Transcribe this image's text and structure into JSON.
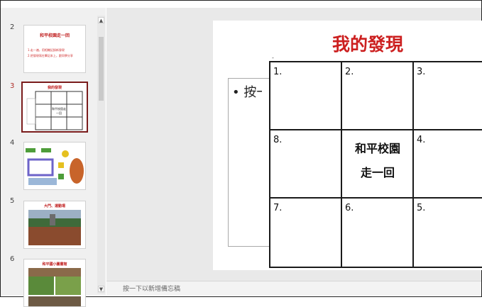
{
  "thumbnails": [
    {
      "num": "2",
      "title": "和平校園走一回",
      "lines": [
        "1.走一遍，用相機記錄新發現",
        "2.把發現寫在筆記本上，跟同學分享"
      ]
    },
    {
      "num": "3",
      "title": "我的發現",
      "center": "和平校園走一回",
      "selected": true
    },
    {
      "num": "4"
    },
    {
      "num": "5",
      "title": "大門、運動場"
    },
    {
      "num": "6",
      "title": "和平國小圖書館"
    }
  ],
  "slide": {
    "title": "我的發現",
    "bullet": "按一",
    "cells": {
      "c1": "1.",
      "c2": "2.",
      "c3": "3.",
      "c8": "8.",
      "c4": "4.",
      "c7": "7.",
      "c6": "6.",
      "c5": "5.",
      "center_line1": "和平校園",
      "center_line2": "走一回"
    }
  },
  "notes_placeholder": "按一下以新增備忘稿",
  "colors": {
    "title_red": "#cc1f1f",
    "selection": "#7a1c1c"
  }
}
